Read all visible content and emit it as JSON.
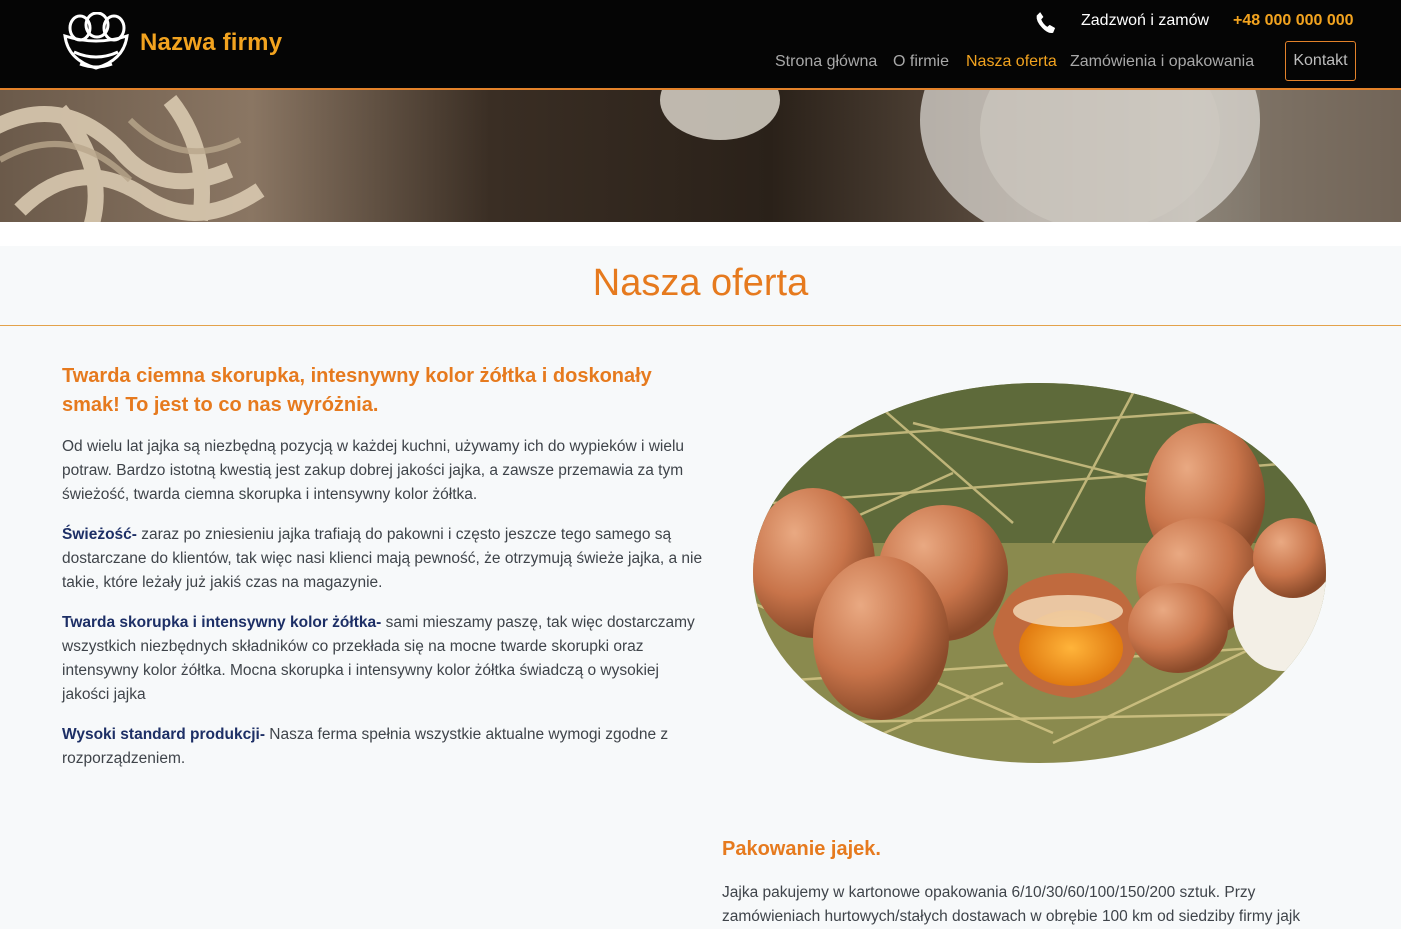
{
  "header": {
    "brand": "Nazwa firmy",
    "call_label": "Zadzwoń i zamów",
    "phone": "+48 000 000 000",
    "nav": [
      {
        "label": "Strona główna",
        "active": false
      },
      {
        "label": "O firmie",
        "active": false
      },
      {
        "label": "Nasza oferta",
        "active": true
      },
      {
        "label": "Zamówienia i opakowania",
        "active": false
      }
    ],
    "contact_label": "Kontakt"
  },
  "colors": {
    "accent": "#e67a1e",
    "brand": "#f2a31f",
    "header_bg": "#050505",
    "bold_text": "#1d2f66"
  },
  "main": {
    "title": "Nasza oferta",
    "headline": "Twarda ciemna skorupka, intesnywny kolor żółtka i doskonały smak! To jest to co nas wyróżnia.",
    "intro": "Od wielu lat jajka są niezbędną pozycją w każdej kuchni, używamy ich do wypieków i wielu potraw. Bardzo istotną kwestią jest zakup dobrej jakości jajka, a zawsze przemawia za tym świeżość, twarda ciemna skorupka i intensywny kolor żółtka.",
    "features": [
      {
        "term": "Świeżość-",
        "text": " zaraz po zniesieniu jajka trafiają do pakowni i często jeszcze tego samego są dostarczane do klientów, tak więc nasi klienci mają pewność, że otrzymują świeże jajka, a nie takie, które leżały już jakiś czas na magazynie."
      },
      {
        "term": "Twarda skorupka i intensywny kolor żółtka-",
        "text": " sami mieszamy paszę, tak więc dostarczamy wszystkich niezbędnych składników co przekłada się na mocne twarde skorupki oraz intensywny kolor żółtka. Mocna skorupka i intensywny kolor żółtka świadczą o wysokiej jakości jajka"
      },
      {
        "term": "Wysoki standard produkcji-",
        "text": " Nasza ferma spełnia wszystkie aktualne wymogi zgodne z rozporządzeniem."
      }
    ],
    "packing": {
      "title": "Pakowanie jajek.",
      "text": "Jajka pakujemy w kartonowe opakowania 6/10/30/60/100/150/200 sztuk. Przy zamówieniach hurtowych/stałych dostawach w obrębie 100 km od siedziby firmy jajk"
    }
  },
  "icons": [
    "egg-basket-logo-icon",
    "phone-icon"
  ]
}
